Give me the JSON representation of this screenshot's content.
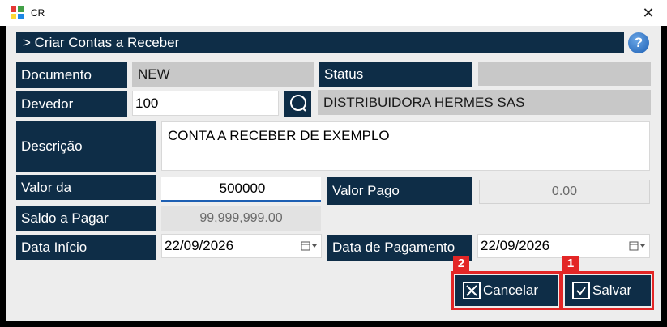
{
  "window": {
    "title": "CR",
    "close_symbol": "✕"
  },
  "header": {
    "title": "> Criar Contas a Receber",
    "help_symbol": "?"
  },
  "form": {
    "documento": {
      "label": "Documento",
      "value": "NEW"
    },
    "status": {
      "label": "Status",
      "value": ""
    },
    "devedor": {
      "label": "Devedor",
      "value": "100",
      "name": "DISTRIBUIDORA HERMES SAS"
    },
    "descricao": {
      "label": "Descrição",
      "value": "CONTA A RECEBER DE EXEMPLO"
    },
    "valor": {
      "label": "Valor da",
      "value": "500000"
    },
    "valor_pago": {
      "label": "Valor Pago",
      "value": "0.00"
    },
    "saldo": {
      "label": "Saldo a Pagar",
      "value": "99,999,999.00"
    },
    "data_inicio": {
      "label": "Data Início",
      "value": "22/09/2026"
    },
    "data_pagamento": {
      "label": "Data de Pagamento",
      "value": "22/09/2026"
    }
  },
  "actions": {
    "cancel_label": "Cancelar",
    "save_label": "Salvar",
    "cancel_badge": "2",
    "save_badge": "1"
  },
  "colors": {
    "label_bg": "#0e2d47",
    "readonly_bg": "#c8c8c8",
    "highlight": "#e32626",
    "help": "#1d5fb3"
  }
}
